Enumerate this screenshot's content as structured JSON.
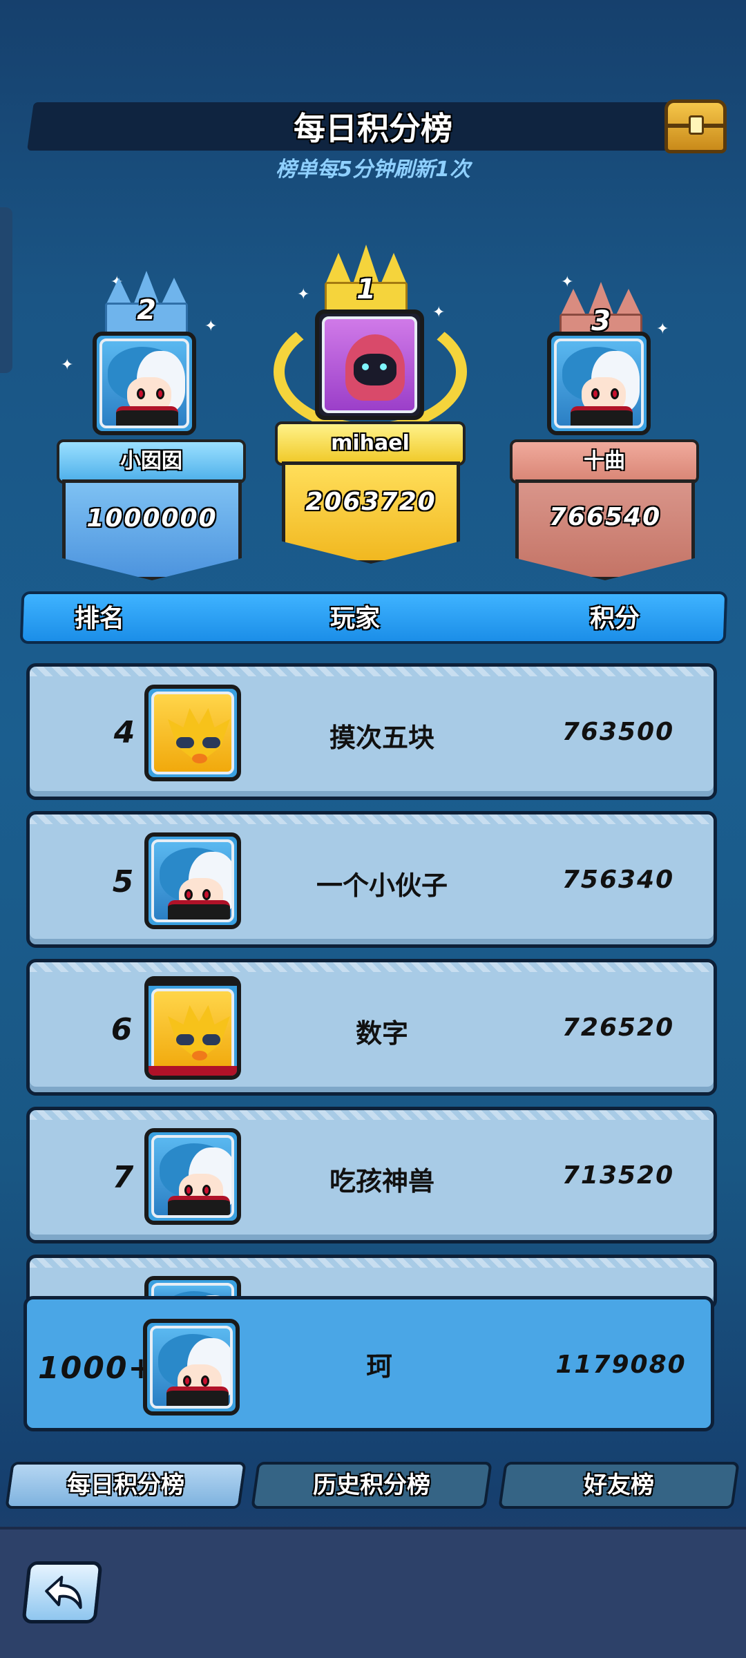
{
  "header": {
    "title": "每日积分榜",
    "subtitle": "榜单每5分钟刷新1次"
  },
  "podium": [
    {
      "rank": "2",
      "name": "小囡囡",
      "score": "1000000"
    },
    {
      "rank": "1",
      "name": "mihael",
      "score": "2063720"
    },
    {
      "rank": "3",
      "name": "十曲",
      "score": "766540"
    }
  ],
  "columns": {
    "rank": "排名",
    "player": "玩家",
    "score": "积分"
  },
  "rows": [
    {
      "rank": "4",
      "name": "摸次五块",
      "score": "763500"
    },
    {
      "rank": "5",
      "name": "一个小伙子",
      "score": "756340"
    },
    {
      "rank": "6",
      "name": "数字",
      "score": "726520"
    },
    {
      "rank": "7",
      "name": "吃孩神兽",
      "score": "713520"
    }
  ],
  "me": {
    "rank": "1000+",
    "name": "珂",
    "score": "1179080"
  },
  "tabs": [
    {
      "label": "每日积分榜",
      "active": true
    },
    {
      "label": "历史积分榜",
      "active": false
    },
    {
      "label": "好友榜",
      "active": false
    }
  ],
  "icons": {
    "chest": "treasure-chest-icon",
    "back": "back-arrow-icon"
  },
  "colors": {
    "gold": "#f5d43c",
    "silver_blue": "#6fb4ec",
    "bronze": "#d98c80",
    "header_row": "#1b8ee8",
    "list_row": "#a8cbe6",
    "my_row": "#4aa6e6"
  }
}
